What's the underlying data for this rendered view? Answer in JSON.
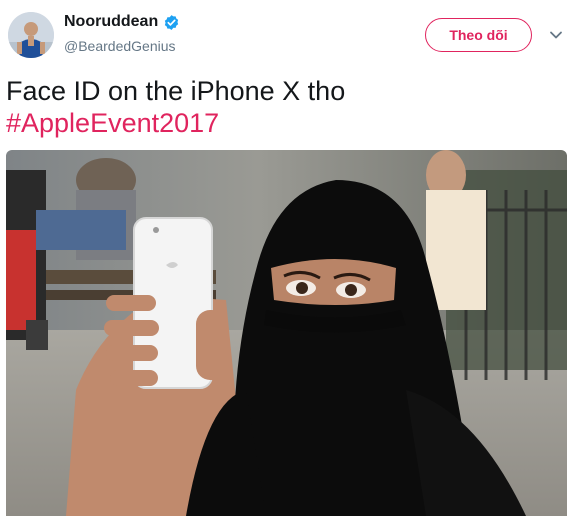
{
  "author": {
    "display_name": "Nooruddean",
    "handle": "@BeardedGenius",
    "verified": true,
    "avatar_icon": "avatar-photo"
  },
  "actions": {
    "follow_label": "Theo dõi",
    "more_icon": "chevron-down-icon"
  },
  "tweet": {
    "text": "Face ID on the iPhone X tho",
    "hashtag": "#AppleEvent2017"
  },
  "media": {
    "type": "photo"
  },
  "colors": {
    "accent": "#e0245e",
    "verified": "#1da1f2",
    "secondary_text": "#657786"
  }
}
